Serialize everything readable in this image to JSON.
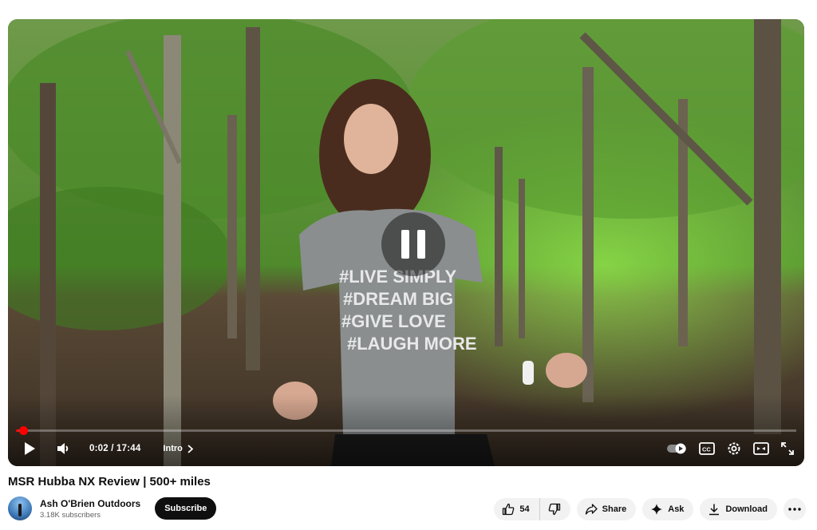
{
  "player": {
    "time_display": "0:02 / 17:44",
    "chapter_label": "Intro",
    "progress_fraction": 0.003
  },
  "video": {
    "title": "MSR Hubba NX Review | 500+ miles"
  },
  "channel": {
    "name": "Ash O'Brien Outdoors",
    "subscribers": "3.18K subscribers",
    "subscribe_label": "Subscribe"
  },
  "actions": {
    "like_count": "54",
    "share_label": "Share",
    "ask_label": "Ask",
    "download_label": "Download"
  },
  "colors": {
    "progress": "#ff0000",
    "subscribe_bg": "#0f0f0f",
    "pill_bg": "#f2f2f2"
  },
  "icons": [
    "play-icon",
    "volume-icon",
    "chevron-right-icon",
    "autoplay-toggle-icon",
    "captions-icon",
    "settings-gear-icon",
    "miniplayer-icon",
    "fullscreen-icon",
    "pause-icon",
    "thumbs-up-icon",
    "thumbs-down-icon",
    "share-icon",
    "sparkle-icon",
    "download-icon",
    "more-icon"
  ]
}
